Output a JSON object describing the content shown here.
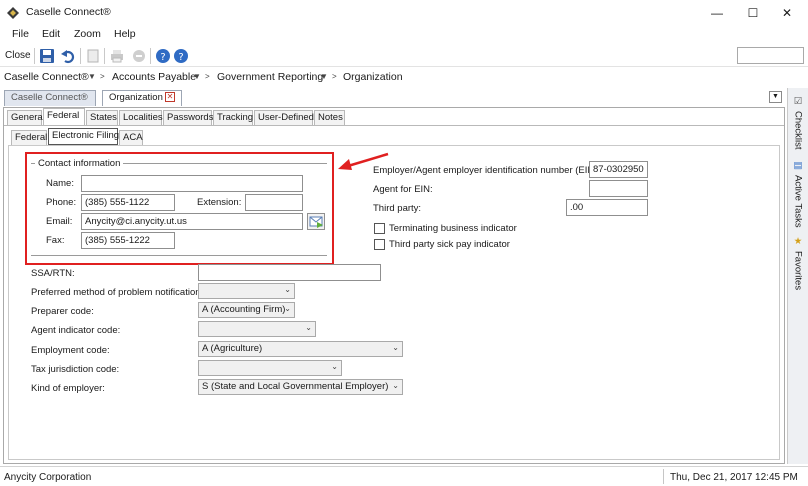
{
  "window": {
    "title": "Caselle Connect®"
  },
  "menu": {
    "items": [
      "File",
      "Edit",
      "Zoom",
      "Help"
    ]
  },
  "toolbar": {
    "close_label": "Close"
  },
  "breadcrumb": {
    "items": [
      "Caselle Connect®",
      "Accounts Payable",
      "Government Reporting",
      "Organization"
    ]
  },
  "doc_tabs": {
    "caselle": "Caselle Connect®",
    "organization": "Organization"
  },
  "section_tabs": [
    "General",
    "Federal",
    "States",
    "Localities",
    "Passwords",
    "Tracking",
    "User-Defined",
    "Notes"
  ],
  "sub_tabs": [
    "Federal",
    "Electronic Filing",
    "ACA"
  ],
  "contact": {
    "legend": "Contact information",
    "name_label": "Name:",
    "name_value": "",
    "phone_label": "Phone:",
    "phone_value": "(385) 555-1122",
    "extension_label": "Extension:",
    "extension_value": "",
    "email_label": "Email:",
    "email_value": "Anycity@ci.anycity.ut.us",
    "fax_label": "Fax:",
    "fax_value": "(385) 555-1222"
  },
  "right": {
    "ein_label": "Employer/Agent employer identification number (EIN):",
    "ein_value": "87-0302950",
    "agent_ein_label": "Agent for EIN:",
    "agent_ein_value": "",
    "third_party_label": "Third party:",
    "third_party_value": ".00",
    "terminating_label": "Terminating business indicator",
    "sick_pay_label": "Third party sick pay indicator"
  },
  "lower": {
    "ssa_label": "SSA/RTN:",
    "ssa_value": "",
    "pref_label": "Preferred method of problem notification:",
    "pref_value": "",
    "preparer_label": "Preparer code:",
    "preparer_value": "A (Accounting Firm)",
    "agent_ind_label": "Agent indicator code:",
    "agent_ind_value": "",
    "employment_label": "Employment code:",
    "employment_value": "A (Agriculture)",
    "tax_juris_label": "Tax jurisdiction code:",
    "tax_juris_value": "",
    "kind_label": "Kind of employer:",
    "kind_value": "S (State and Local Governmental Employer)"
  },
  "side_tabs": [
    "Checklist",
    "Active Tasks",
    "Favorites"
  ],
  "status": {
    "left": "Anycity Corporation",
    "right": "Thu, Dec 21, 2017 12:45 PM"
  },
  "colors": {
    "highlight": "#ffff33",
    "annotation": "#e02020",
    "tab_border": "#9da6b4"
  }
}
